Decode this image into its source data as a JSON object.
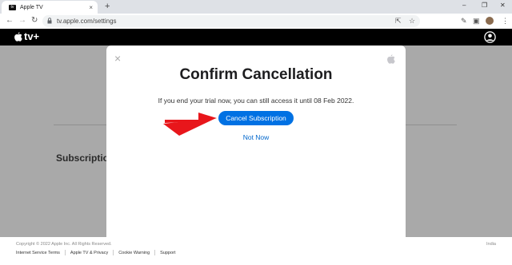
{
  "browser": {
    "tab_title": "Apple TV",
    "favicon_label": "tv",
    "url": "tv.apple.com/settings",
    "close_glyph": "×",
    "new_tab_glyph": "+",
    "icons": [
      "back-icon",
      "forward-icon",
      "reload-icon",
      "lock-icon",
      "share-icon",
      "star-icon",
      "extensions-icon",
      "sidebar-icon",
      "menu-icon",
      "minimize-icon",
      "restore-icon",
      "close-icon"
    ]
  },
  "app": {
    "logo_text": "tv+",
    "icons": [
      "apple-logo-icon",
      "user-account-icon"
    ]
  },
  "page": {
    "subscriptions_label": "Subscriptions"
  },
  "modal": {
    "title": "Confirm Cancellation",
    "message": "If you end your trial now, you can still access it until 08 Feb 2022.",
    "primary_button": "Cancel Subscription",
    "secondary_link": "Not Now",
    "close_glyph": "×",
    "accent_color": "#0071e3",
    "link_color": "#0066cc"
  },
  "annotation": {
    "arrow_color": "#e8161b"
  },
  "footer": {
    "copyright": "Copyright © 2022 Apple Inc. All Rights Reserved.",
    "region": "India",
    "links": [
      "Internet Service Terms",
      "Apple TV & Privacy",
      "Cookie Warning",
      "Support"
    ]
  }
}
